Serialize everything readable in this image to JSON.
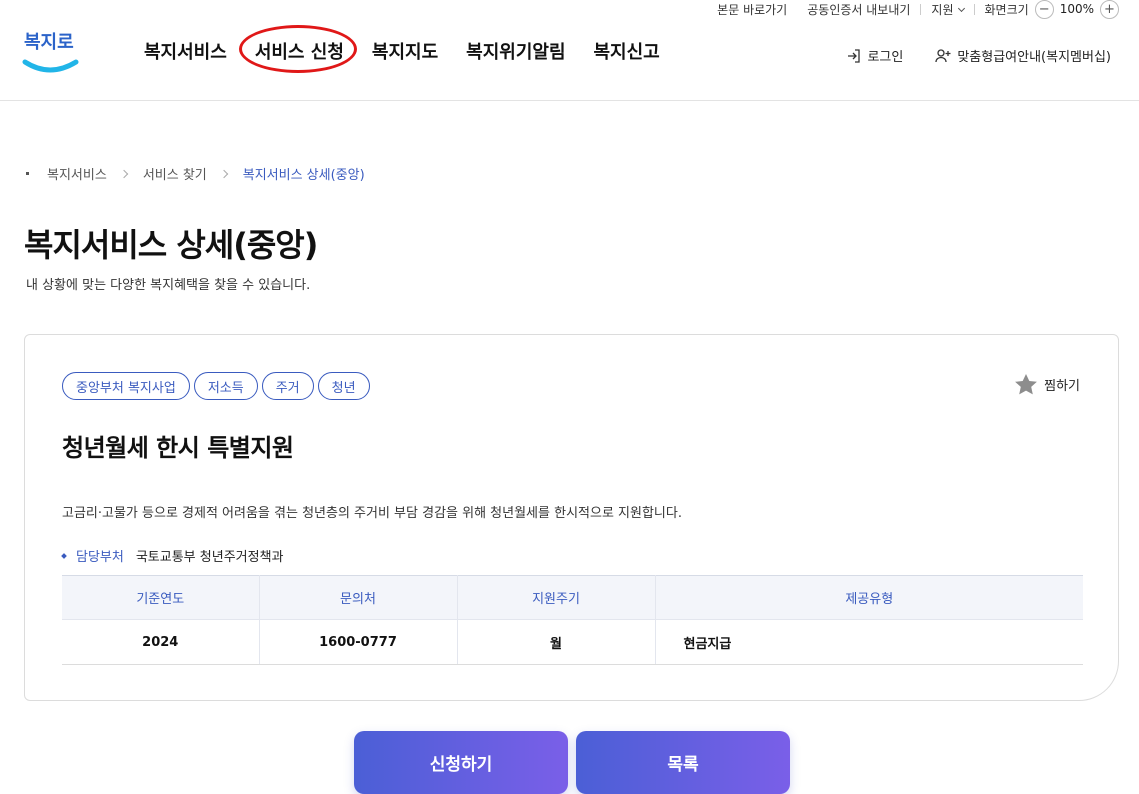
{
  "utility": {
    "skip_to_content": "본문 바로가기",
    "cert_export": "공동인증서 내보내기",
    "support": "지원",
    "screen_size": "화면크기",
    "zoom_minus": "−",
    "zoom_level": "100%",
    "zoom_plus": "+"
  },
  "header": {
    "logo_text": "복지로",
    "nav": [
      "복지서비스",
      "서비스 신청",
      "복지지도",
      "복지위기알림",
      "복지신고"
    ],
    "login": "로그인",
    "membership": "맞춤형급여안내(복지멤버십)"
  },
  "breadcrumb": [
    "복지서비스",
    "서비스 찾기",
    "복지서비스 상세(중앙)"
  ],
  "page": {
    "title": "복지서비스 상세(중앙)",
    "description": "내 상황에 맞는 다양한 복지혜택을 찾을 수 있습니다."
  },
  "service": {
    "tags": [
      "중앙부처 복지사업",
      "저소득",
      "주거",
      "청년"
    ],
    "favorite": "찜하기",
    "title": "청년월세 한시 특별지원",
    "description": "고금리·고물가 등으로 경제적 어려움을 겪는 청년층의 주거비 부담 경감을 위해 청년월세를 한시적으로 지원합니다.",
    "dept_label": "담당부처",
    "dept_value": "국토교통부 청년주거정책과",
    "table": {
      "headers": [
        "기준연도",
        "문의처",
        "지원주기",
        "제공유형"
      ],
      "row": [
        "2024",
        "1600-0777",
        "월",
        "현금지급"
      ]
    }
  },
  "actions": {
    "apply": "신청하기",
    "list": "목록"
  },
  "colors": {
    "accent": "#3a5bbf",
    "highlight_circle": "#e01818",
    "button_gradient_start": "#4b5fd6",
    "button_gradient_end": "#7a5fe8"
  }
}
